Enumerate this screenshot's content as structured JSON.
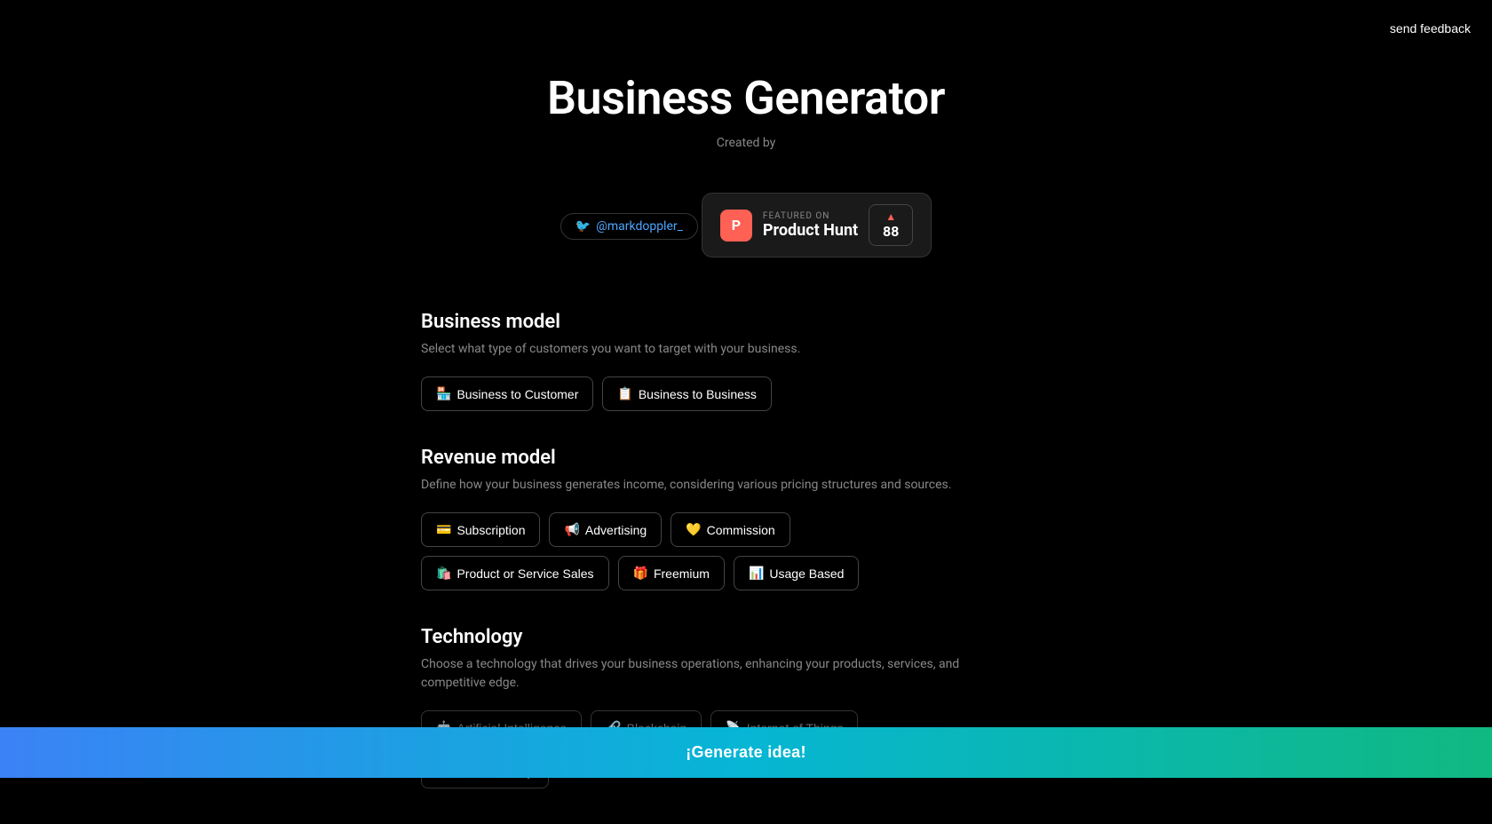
{
  "feedback": {
    "label": "send feedback"
  },
  "header": {
    "title": "Business Generator",
    "created_by": "Created by",
    "twitter_handle": "@markdoppler_",
    "product_hunt": {
      "featured_label": "FEATURED ON",
      "name": "Product Hunt",
      "votes": "88",
      "logo_letter": "P"
    }
  },
  "sections": {
    "business_model": {
      "title": "Business model",
      "description": "Select what type of customers you want to target with your business.",
      "options": [
        {
          "emoji": "🏪",
          "label": "Business to Customer"
        },
        {
          "emoji": "📋",
          "label": "Business to Business"
        }
      ]
    },
    "revenue_model": {
      "title": "Revenue model",
      "description": "Define how your business generates income, considering various pricing structures and sources.",
      "options": [
        {
          "emoji": "💳",
          "label": "Subscription"
        },
        {
          "emoji": "📢",
          "label": "Advertising"
        },
        {
          "emoji": "💛",
          "label": "Commission"
        },
        {
          "emoji": "🛍️",
          "label": "Product or Service Sales"
        },
        {
          "emoji": "🎁",
          "label": "Freemium"
        },
        {
          "emoji": "📊",
          "label": "Usage Based"
        }
      ]
    },
    "technology": {
      "title": "Technology",
      "description": "Choose a technology that drives your business operations, enhancing your products, services, and competitive edge.",
      "options": [
        {
          "emoji": "🤖",
          "label": "Artificial Intelligence"
        },
        {
          "emoji": "🔗",
          "label": "Blockchain"
        },
        {
          "emoji": "📡",
          "label": "Internet of Things"
        },
        {
          "emoji": "🥽",
          "label": "Virtual Reality"
        }
      ]
    }
  },
  "generate": {
    "label": "¡Generate idea!"
  }
}
